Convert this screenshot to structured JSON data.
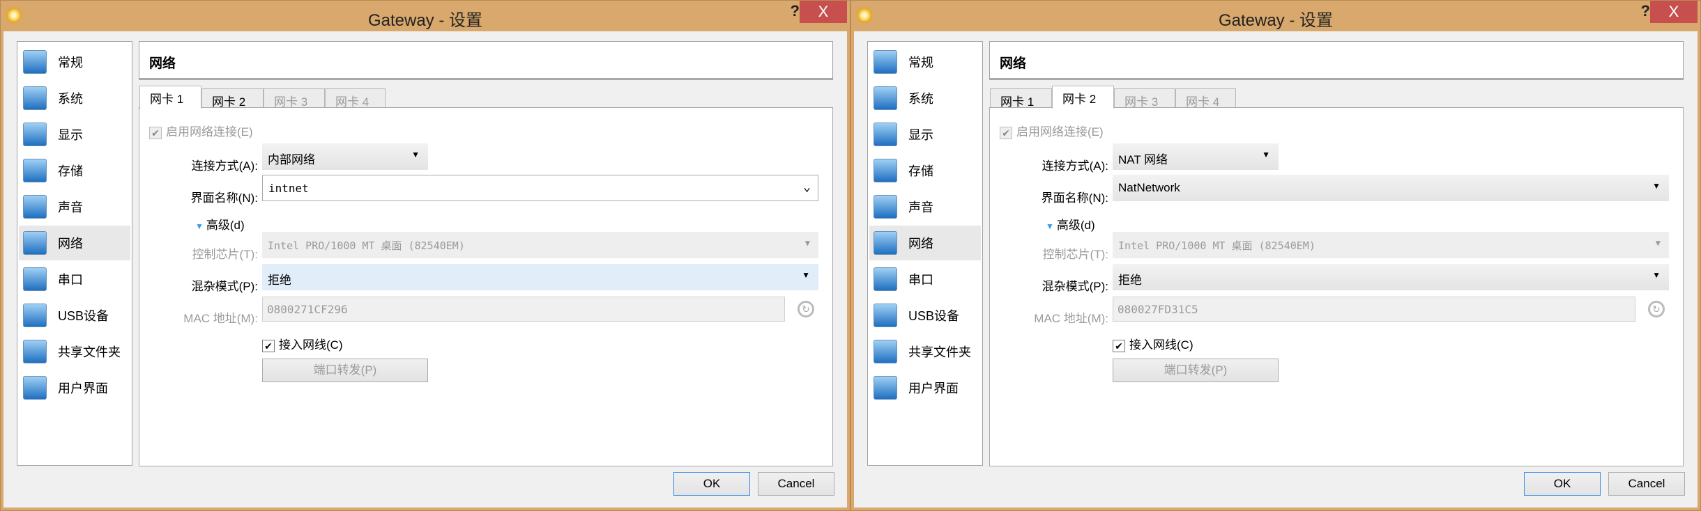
{
  "colors": {
    "titlebar": "#d9a86c",
    "close": "#c7504f",
    "accent": "#3c8ce6"
  },
  "windows": [
    {
      "title": "Gateway - 设置",
      "help": "?",
      "close": "X",
      "sidebar": [
        {
          "label": "常规",
          "icon": "monitor-icon"
        },
        {
          "label": "系统",
          "icon": "chip-icon"
        },
        {
          "label": "显示",
          "icon": "display-icon"
        },
        {
          "label": "存储",
          "icon": "disk-icon"
        },
        {
          "label": "声音",
          "icon": "speaker-icon"
        },
        {
          "label": "网络",
          "icon": "network-icon",
          "selected": true
        },
        {
          "label": "串口",
          "icon": "serial-port-icon"
        },
        {
          "label": "USB设备",
          "icon": "usb-icon"
        },
        {
          "label": "共享文件夹",
          "icon": "folder-icon"
        },
        {
          "label": "用户界面",
          "icon": "window-icon"
        }
      ],
      "header": "网络",
      "tabs": [
        {
          "label": "网卡 1",
          "state": "sel"
        },
        {
          "label": "网卡 2",
          "state": ""
        },
        {
          "label": "网卡 3",
          "state": "dis"
        },
        {
          "label": "网卡 4",
          "state": "dis"
        }
      ],
      "enable": "启用网络连接(E)",
      "attach_label": "连接方式(A):",
      "attach_value": "内部网络",
      "name_label": "界面名称(N):",
      "name_value": "intnet",
      "name_editable": true,
      "advanced": "高级(d)",
      "adapter_label": "控制芯片(T):",
      "adapter_value": "Intel PRO/1000 MT 桌面 (82540EM)",
      "promisc_label": "混杂模式(P):",
      "promisc_value": "拒绝",
      "promisc_highlight": true,
      "mac_label": "MAC 地址(M):",
      "mac_value": "0800271CF296",
      "cable": "接入网线(C)",
      "port_forward": "端口转发(P)",
      "ok": "OK",
      "cancel": "Cancel"
    },
    {
      "title": "Gateway - 设置",
      "help": "?",
      "close": "X",
      "sidebar": [
        {
          "label": "常规",
          "icon": "monitor-icon"
        },
        {
          "label": "系统",
          "icon": "chip-icon"
        },
        {
          "label": "显示",
          "icon": "display-icon"
        },
        {
          "label": "存储",
          "icon": "disk-icon"
        },
        {
          "label": "声音",
          "icon": "speaker-icon"
        },
        {
          "label": "网络",
          "icon": "network-icon",
          "selected": true
        },
        {
          "label": "串口",
          "icon": "serial-port-icon"
        },
        {
          "label": "USB设备",
          "icon": "usb-icon"
        },
        {
          "label": "共享文件夹",
          "icon": "folder-icon"
        },
        {
          "label": "用户界面",
          "icon": "window-icon"
        }
      ],
      "header": "网络",
      "tabs": [
        {
          "label": "网卡 1",
          "state": ""
        },
        {
          "label": "网卡 2",
          "state": "sel"
        },
        {
          "label": "网卡 3",
          "state": "dis"
        },
        {
          "label": "网卡 4",
          "state": "dis"
        }
      ],
      "enable": "启用网络连接(E)",
      "attach_label": "连接方式(A):",
      "attach_value": "NAT 网络",
      "name_label": "界面名称(N):",
      "name_value": "NatNetwork",
      "name_editable": false,
      "advanced": "高级(d)",
      "adapter_label": "控制芯片(T):",
      "adapter_value": "Intel PRO/1000 MT 桌面 (82540EM)",
      "promisc_label": "混杂模式(P):",
      "promisc_value": "拒绝",
      "promisc_highlight": false,
      "mac_label": "MAC 地址(M):",
      "mac_value": "080027FD31C5",
      "cable": "接入网线(C)",
      "port_forward": "端口转发(P)",
      "ok": "OK",
      "cancel": "Cancel"
    }
  ]
}
